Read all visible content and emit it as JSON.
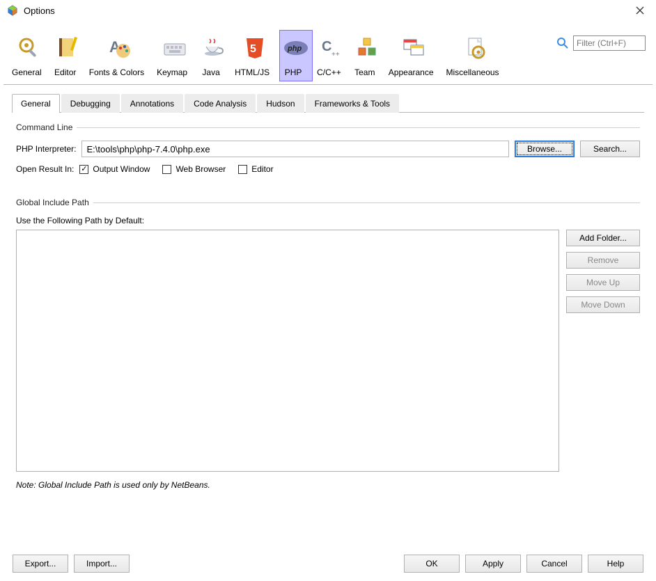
{
  "window": {
    "title": "Options"
  },
  "toolbar": {
    "categories": [
      {
        "label": "General"
      },
      {
        "label": "Editor"
      },
      {
        "label": "Fonts & Colors"
      },
      {
        "label": "Keymap"
      },
      {
        "label": "Java"
      },
      {
        "label": "HTML/JS"
      },
      {
        "label": "PHP"
      },
      {
        "label": "C/C++"
      },
      {
        "label": "Team"
      },
      {
        "label": "Appearance"
      },
      {
        "label": "Miscellaneous"
      }
    ],
    "selected_index": 6,
    "filter_placeholder": "Filter (Ctrl+F)"
  },
  "tabs": {
    "items": [
      {
        "label": "General"
      },
      {
        "label": "Debugging"
      },
      {
        "label": "Annotations"
      },
      {
        "label": "Code Analysis"
      },
      {
        "label": "Hudson"
      },
      {
        "label": "Frameworks & Tools"
      }
    ],
    "active_index": 0
  },
  "command_line": {
    "legend": "Command Line",
    "interpreter_label": "PHP Interpreter:",
    "interpreter_value": "E:\\tools\\php\\php-7.4.0\\php.exe",
    "browse_label": "Browse...",
    "search_label": "Search...",
    "open_result_label": "Open Result In:",
    "checks": [
      {
        "label": "Output Window",
        "checked": true
      },
      {
        "label": "Web Browser",
        "checked": false
      },
      {
        "label": "Editor",
        "checked": false
      }
    ]
  },
  "global_include": {
    "legend": "Global Include Path",
    "use_path_label": "Use the Following Path by Default:",
    "buttons": {
      "add_folder": "Add Folder...",
      "remove": "Remove",
      "move_up": "Move Up",
      "move_down": "Move Down"
    },
    "note": "Note: Global Include Path is used only by NetBeans."
  },
  "footer": {
    "export": "Export...",
    "import": "Import...",
    "ok": "OK",
    "apply": "Apply",
    "cancel": "Cancel",
    "help": "Help"
  }
}
